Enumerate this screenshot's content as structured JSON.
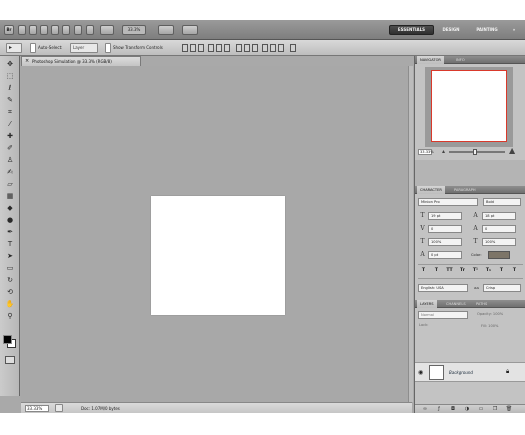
{
  "appbar": {
    "logo": "Br",
    "zoom_value": "33.3%",
    "workspaces": [
      "ESSENTIALS",
      "DESIGN",
      "PAINTING"
    ],
    "more": "»"
  },
  "options": {
    "tool_glyph": "▸",
    "auto_select_label": "Auto-Select:",
    "auto_select_value": "Layer",
    "show_transform_label": "Show Transform Controls"
  },
  "toolbox": {
    "tools": [
      {
        "name": "move-tool-icon",
        "glyph": "✥"
      },
      {
        "name": "marquee-tool-icon",
        "glyph": "⬚"
      },
      {
        "name": "lasso-tool-icon",
        "glyph": "ℓ"
      },
      {
        "name": "quick-select-tool-icon",
        "glyph": "✎"
      },
      {
        "name": "crop-tool-icon",
        "glyph": "⌗"
      },
      {
        "name": "eyedropper-tool-icon",
        "glyph": "⁄"
      },
      {
        "name": "healing-brush-tool-icon",
        "glyph": "✚"
      },
      {
        "name": "brush-tool-icon",
        "glyph": "✐"
      },
      {
        "name": "clone-stamp-tool-icon",
        "glyph": "♙"
      },
      {
        "name": "history-brush-tool-icon",
        "glyph": "✍"
      },
      {
        "name": "eraser-tool-icon",
        "glyph": "▱"
      },
      {
        "name": "gradient-tool-icon",
        "glyph": "▦"
      },
      {
        "name": "blur-tool-icon",
        "glyph": "◆"
      },
      {
        "name": "dodge-tool-icon",
        "glyph": "●"
      },
      {
        "name": "pen-tool-icon",
        "glyph": "✒"
      },
      {
        "name": "type-tool-icon",
        "glyph": "T"
      },
      {
        "name": "path-select-tool-icon",
        "glyph": "➤"
      },
      {
        "name": "shape-tool-icon",
        "glyph": "▭"
      },
      {
        "name": "3d-rotate-tool-icon",
        "glyph": "↻"
      },
      {
        "name": "3d-orbit-tool-icon",
        "glyph": "⟲"
      },
      {
        "name": "hand-tool-icon",
        "glyph": "✋"
      },
      {
        "name": "zoom-tool-icon",
        "glyph": "⚲"
      }
    ]
  },
  "document": {
    "tab_title": "Photoshop Simulation @ 33.3% (RGB/8)",
    "close_glyph": "×",
    "status_zoom": "33.33%",
    "status_doc": "Doc: 1.07M/0 bytes"
  },
  "navigator": {
    "tabs": [
      "NAVIGATOR",
      "INFO"
    ],
    "zoom": "33.33%"
  },
  "character": {
    "tabs": [
      "CHARACTER",
      "PARAGRAPH"
    ],
    "font_family": "Minion Pro",
    "font_style": "Bold",
    "font_size": "19 pt",
    "leading": "18 pt",
    "kerning": "0",
    "tracking": "0",
    "vscale": "100%",
    "hscale": "100%",
    "baseline": "0 pt",
    "color_label": "Color:",
    "color_hex": "#7d7568",
    "format_buttons": [
      "T",
      "T",
      "TT",
      "Tr",
      "T¹",
      "T₁",
      "T",
      "T"
    ],
    "language": "English: USA",
    "antialias": "Crisp",
    "aa_glyph": "aa"
  },
  "layers": {
    "tabs": [
      "LAYERS",
      "CHANNELS",
      "PATHS"
    ],
    "blend_mode": "Normal",
    "opacity_label": "Opacity: 100%",
    "lock_label": "Lock:",
    "fill_label": "Fill: 100%",
    "background_layer": "Background",
    "footer_icons": [
      "link-icon",
      "fx-icon",
      "mask-icon",
      "adjustment-icon",
      "folder-icon",
      "new-layer-icon",
      "trash-icon"
    ]
  }
}
